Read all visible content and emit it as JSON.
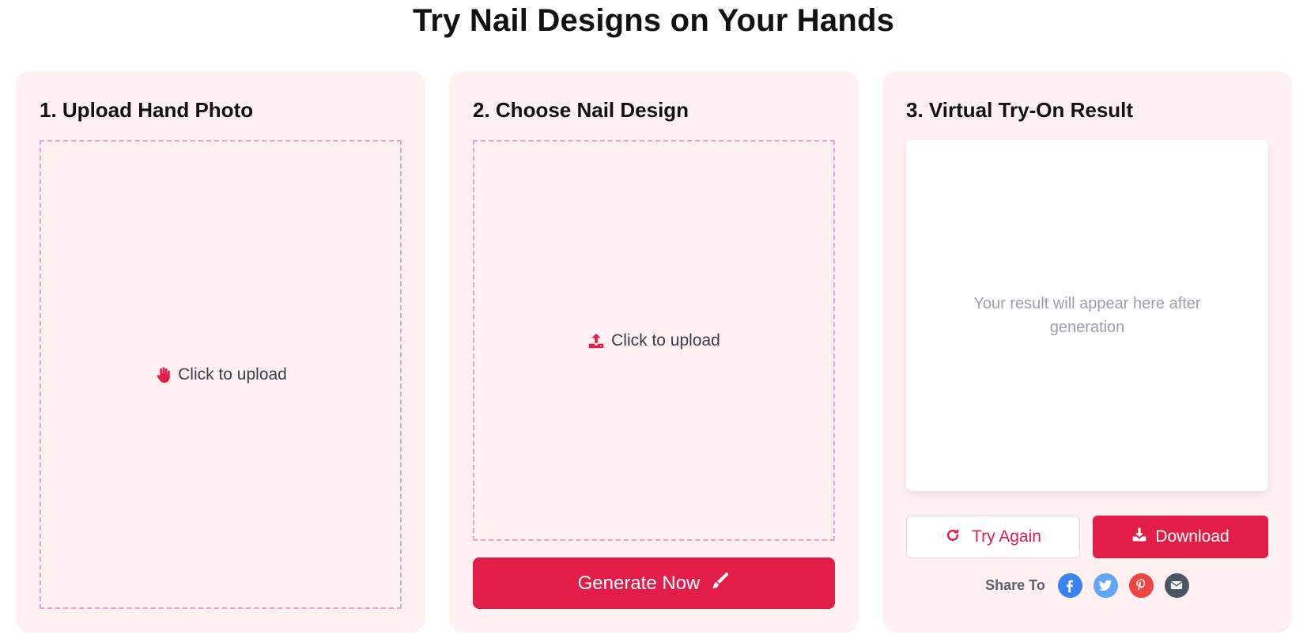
{
  "page": {
    "title": "Try Nail Designs on Your Hands"
  },
  "upload_hand": {
    "title": "1. Upload Hand Photo",
    "dropzone_label": "Click to upload",
    "icon": "hand-icon"
  },
  "nail_design": {
    "title": "2. Choose Nail Design",
    "dropzone_label": "Click to upload",
    "icon": "upload-icon",
    "generate_label": "Generate Now",
    "generate_icon": "brush-icon"
  },
  "result": {
    "title": "3. Virtual Try-On Result",
    "placeholder": "Your result will appear here after generation",
    "try_again_label": "Try Again",
    "download_label": "Download",
    "share_label": "Share To",
    "share_targets": [
      "facebook",
      "twitter",
      "pinterest",
      "email"
    ]
  },
  "colors": {
    "accent": "#e11d48",
    "card_background": "#fff0f2",
    "dashed_border": "#f0a0cc",
    "facebook": "#3b82f6",
    "twitter": "#60a5fa",
    "pinterest": "#ef4444",
    "email": "#4b5563"
  }
}
